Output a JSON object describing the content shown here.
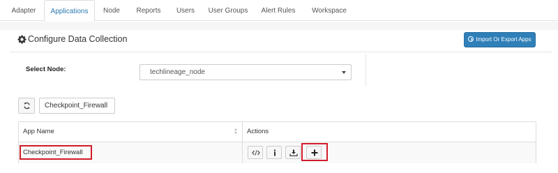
{
  "tabs": [
    {
      "label": "Adapter",
      "active": false
    },
    {
      "label": "Applications",
      "active": true
    },
    {
      "label": "Node",
      "active": false
    },
    {
      "label": "Reports",
      "active": false
    },
    {
      "label": "Users",
      "active": false
    },
    {
      "label": "User Groups",
      "active": false
    },
    {
      "label": "Alert Rules",
      "active": false
    },
    {
      "label": "Workspace",
      "active": false
    }
  ],
  "header": {
    "title": "Configure Data Collection",
    "title_icon": "gear-icon",
    "import_export_label": "Import Or Export Apps",
    "import_export_icon": "circle-arrow-icon"
  },
  "node_select": {
    "label": "Select Node:",
    "value": "techlineage_node"
  },
  "filter": {
    "refresh_icon": "refresh-icon",
    "value": "Checkpoint_Firewall"
  },
  "table": {
    "columns": [
      "App Name",
      "Actions"
    ],
    "rows": [
      {
        "app_name": "Checkpoint_Firewall",
        "actions": [
          "code-icon",
          "info-icon",
          "download-icon",
          "plus-icon"
        ]
      }
    ]
  },
  "colors": {
    "accent": "#2f7fb8",
    "highlight": "#d11c2a"
  }
}
